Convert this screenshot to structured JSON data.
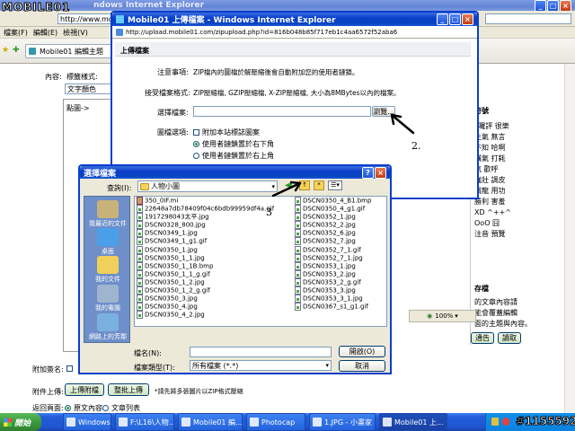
{
  "watermark_left": "MOBILE01",
  "bg_window": {
    "title": "ndows Internet Explorer",
    "address": "http://www.mo",
    "menu": [
      "檔案(F)",
      "編輯(E)",
      "檢視(V)"
    ],
    "tab_label": "Mobile01 編輯主題",
    "content_label": "內容:",
    "style_label": "標籤樣式:",
    "font_color_label": "文字顏色",
    "body_text": "點圖->",
    "attach_sig_label": "附加簽名:",
    "attach_upload_label": "附件上傳:",
    "upload_attach_btn": "上傳附檔",
    "organize_upload_btn": "整批上傳",
    "zip_note": "*請先將多張圖片以ZIP格式壓縮",
    "return_label": "返回頁面:",
    "return_opt1": "原文內容",
    "return_opt2": "文章列表",
    "right_panel": {
      "header": "符號",
      "rows": [
        "?囉評 很樂",
        "生氣 無言",
        "不知 哈啊",
        "橫氣 打耗",
        "氣 歡呼",
        "強壯 調皮",
        "霸龍 用功",
        "勝利 害羞",
        "XD ^++^",
        "OoO 囧",
        "注音 預覽"
      ],
      "draft_header": "存檔",
      "draft_line1": "的文章內容請",
      "draft_line2": "能會覆蓋編輯",
      "draft_line3": "面的主題與內容。",
      "save_btn": "通告",
      "read_btn": "讀取"
    }
  },
  "ie_popup": {
    "title": "Mobile01 上傳檔案 - Windows Internet Explorer",
    "address": "http://upload.mobile01.com/zipupload.php?id=816b048b85f717eb1c4aa6572f52aba6",
    "section_title": "上傳檔案",
    "notice_label": "注意事項:",
    "notice_text": "ZIP檔內的圖檔於解壓縮後會自動附加您的使用者鏈鎖。",
    "accept_label": "接受檔案格式:",
    "accept_text": "ZIP壓縮檔, GZIP壓縮檔, X-ZIP壓縮檔, 大小為8MBytes以內的檔案。",
    "select_label": "選擇檔案:",
    "browse_btn": "瀏覽...",
    "image_opts_label": "圖檔選項:",
    "opt_watermark": "附加本站標誌圖案",
    "opt_bottom_right": "使用者鏈鎖置於右下角",
    "opt_top_right": "使用者鏈鎖置於右上角",
    "zoom": "100%"
  },
  "annotations": {
    "a2": "2.",
    "a3": "3"
  },
  "file_dialog": {
    "title": "選擇檔案",
    "lookin_label": "查詢(I):",
    "lookin_value": "人物小圖",
    "places": [
      "我最近的文件",
      "桌面",
      "我的文件",
      "我的電腦",
      "網路上的芳鄰"
    ],
    "files_col1": [
      "350_0IF.mi",
      "22648a7db78409f04c6bdb99959df4a.gif",
      "1917298043太平.jpg",
      "DSCN0328_800.jpg",
      "DSCN0349_1.jpg",
      "DSCN0349_1_g1.gif",
      "DSCN0350_1.jpg",
      "DSCN0350_1_1.jpg",
      "DSCN0350_1_1B.bmp",
      "DSCN0350_1_1_g.gif",
      "DSCN0350_1_2.jpg",
      "DSCN0350_1_2_g.gif",
      "DSCN0350_3.jpg",
      "DSCN0350_4.jpg",
      "DSCN0350_4_2.jpg"
    ],
    "files_col2": [
      "DSCN0350_4_B1.bmp",
      "DSCN0350_4_g1.gif",
      "DSCN0352_1.jpg",
      "DSCN0352_2.jpg",
      "DSCN0352_6.jpg",
      "DSCN0352_7.jpg",
      "DSCN0352_7_1.gif",
      "DSCN0352_7_1.jpg",
      "DSCN0353_1.jpg",
      "DSCN0353_2.jpg",
      "DSCN0353_2_g.gif",
      "DSCN0353_3.jpg",
      "DSCN0353_3_1.jpg",
      "DSCN0367_s1_g1.gif"
    ],
    "filename_label": "檔名(N):",
    "filetype_label": "檔案類型(T):",
    "filetype_value": "所有檔案 (*.*)",
    "open_btn": "開啟(O)",
    "cancel_btn": "取消"
  },
  "taskbar": {
    "start": "開始",
    "tasks": [
      "Windows 工",
      "F:\\L16\\人物...",
      "Mobile01 編...",
      "Photocap",
      "1.JPG - 小畫家",
      "Mobile01 上..."
    ],
    "watermark": "#1155592"
  },
  "colors": {
    "xp_blue": "#0a3fcb",
    "desktop_taskbar": "#245edb",
    "start_green": "#3c9a3c",
    "dialog_bg": "#ece9d8"
  }
}
